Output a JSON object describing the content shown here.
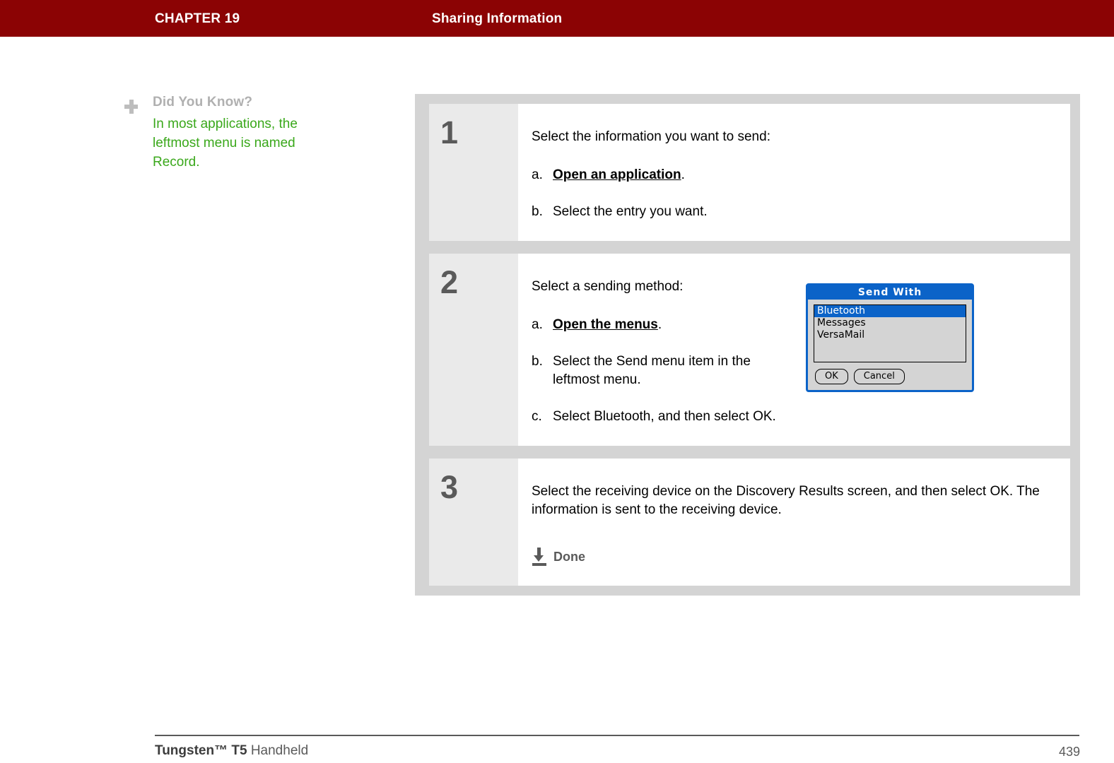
{
  "header": {
    "chapter_label": "CHAPTER 19",
    "chapter_title": "Sharing Information",
    "background_color": "#8b0304",
    "text_color": "#ffffff"
  },
  "tip": {
    "icon": "plus-icon",
    "heading": "Did You Know?",
    "body": "In most applications, the leftmost menu is named Record.",
    "heading_color": "#b0b0b0",
    "body_color": "#3aa81b"
  },
  "steps": [
    {
      "number": "1",
      "lead": "Select the information you want to send:",
      "substeps": [
        {
          "marker": "a.",
          "text_before": "",
          "link": "Open an application",
          "text_after": "."
        },
        {
          "marker": "b.",
          "text_before": "Select the entry you want.",
          "link": "",
          "text_after": ""
        }
      ]
    },
    {
      "number": "2",
      "lead": "Select a sending method:",
      "substeps": [
        {
          "marker": "a.",
          "text_before": "",
          "link": "Open the menus",
          "text_after": "."
        },
        {
          "marker": "b.",
          "text_before": "Select the Send menu item in the leftmost menu.",
          "link": "",
          "text_after": ""
        },
        {
          "marker": "c.",
          "text_before": "Select Bluetooth, and then select OK.",
          "link": "",
          "text_after": ""
        }
      ]
    },
    {
      "number": "3",
      "body": "Select the receiving device on the Discovery Results screen, and then select OK. The information is sent to the receiving device.",
      "done_label": "Done",
      "done_icon": "down-arrow-to-bar-icon"
    }
  ],
  "dialog": {
    "title": "Send With",
    "title_bar_color": "#0b63c8",
    "body_color": "#d4d4d4",
    "list_items": [
      {
        "label": "Bluetooth",
        "selected": true
      },
      {
        "label": "Messages",
        "selected": false
      },
      {
        "label": "VersaMail",
        "selected": false
      }
    ],
    "buttons": [
      {
        "label": "OK"
      },
      {
        "label": "Cancel"
      }
    ]
  },
  "footer": {
    "product_brand": "Tungsten™ T5",
    "product_type": " Handheld",
    "page_number": "439"
  }
}
